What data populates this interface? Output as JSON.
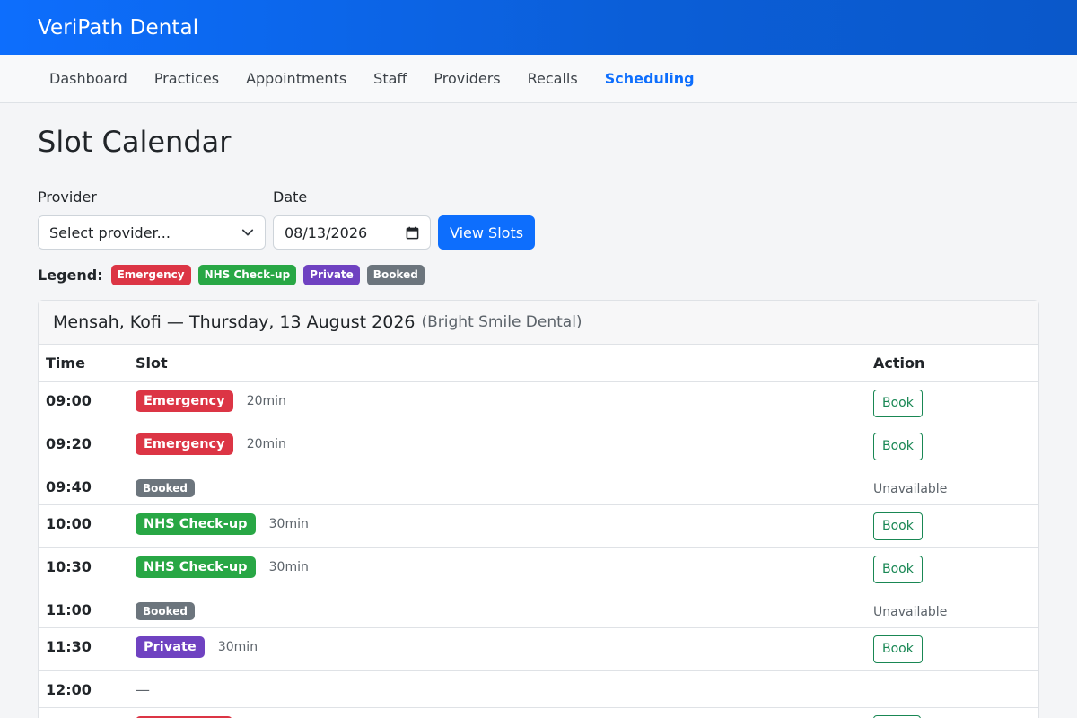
{
  "app": {
    "brand": "VeriPath Dental"
  },
  "nav": {
    "items": [
      {
        "label": "Dashboard"
      },
      {
        "label": "Practices"
      },
      {
        "label": "Appointments"
      },
      {
        "label": "Staff"
      },
      {
        "label": "Providers"
      },
      {
        "label": "Recalls"
      },
      {
        "label": "Scheduling"
      }
    ],
    "active": "Scheduling"
  },
  "page": {
    "title": "Slot Calendar"
  },
  "form": {
    "provider_label": "Provider",
    "provider_value": "Select provider...",
    "date_label": "Date",
    "date_value": "08/13/2026",
    "submit_label": "View Slots"
  },
  "legend": {
    "label": "Legend:",
    "items": [
      {
        "label": "Emergency",
        "color": "#dc3545"
      },
      {
        "label": "NHS Check-up",
        "color": "#28a745"
      },
      {
        "label": "Private",
        "color": "#6f42c1"
      },
      {
        "label": "Booked",
        "color": "#6c757d"
      }
    ]
  },
  "schedule": {
    "provider_date": "Mensah, Kofi — Thursday, 13 August 2026",
    "practice": "(Bright Smile Dental)",
    "columns": {
      "time": "Time",
      "slot": "Slot",
      "action": "Action"
    },
    "rows": [
      {
        "time": "09:00",
        "slot": "Emergency",
        "duration": "20min",
        "action": "Book"
      },
      {
        "time": "09:20",
        "slot": "Emergency",
        "duration": "20min",
        "action": "Book"
      },
      {
        "time": "09:40",
        "slot": "Booked",
        "duration": "",
        "action": "Unavailable"
      },
      {
        "time": "10:00",
        "slot": "NHS Check-up",
        "duration": "30min",
        "action": "Book"
      },
      {
        "time": "10:30",
        "slot": "NHS Check-up",
        "duration": "30min",
        "action": "Book"
      },
      {
        "time": "11:00",
        "slot": "Booked",
        "duration": "",
        "action": "Unavailable"
      },
      {
        "time": "11:30",
        "slot": "Private",
        "duration": "30min",
        "action": "Book"
      },
      {
        "time": "12:00",
        "slot": "—",
        "duration": "",
        "action": ""
      }
    ]
  }
}
